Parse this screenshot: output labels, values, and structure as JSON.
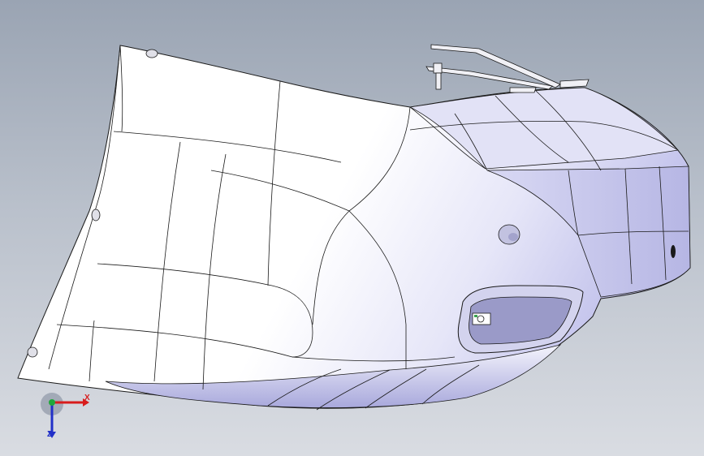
{
  "view": {
    "background_top": "#9aa4b3",
    "background_bottom": "#d9dce2",
    "model_name": "rear-bumper-cover",
    "model_face_light": "#ffffff",
    "model_face_shade": "#b9b9e8",
    "edge_color": "#1a1a1a"
  },
  "triad": {
    "x_label": "X",
    "z_label": "Z",
    "x_color": "#d81c1c",
    "y_color": "#1fa83a",
    "z_color": "#2130c8",
    "icon": "coordinate-triad-icon"
  }
}
